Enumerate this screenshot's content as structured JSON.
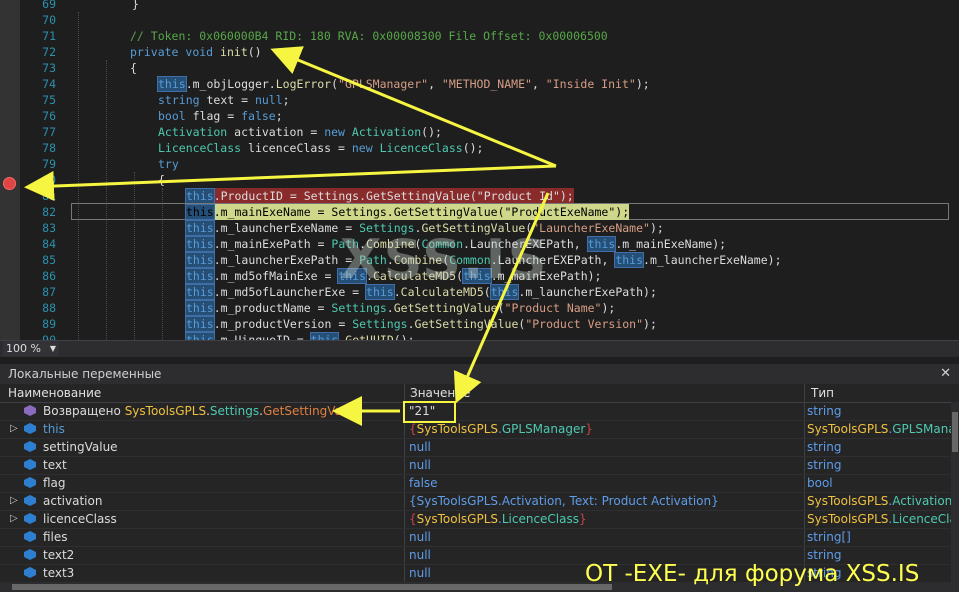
{
  "editor": {
    "lines": [
      {
        "n": "69",
        "parts": [
          {
            "t": "}",
            "c": ""
          }
        ]
      },
      {
        "n": "70",
        "parts": []
      },
      {
        "n": "71",
        "parts": [
          {
            "t": "// Token: 0x060000B4 RID: 180 RVA: 0x00008300 File Offset: 0x00006500",
            "c": "cm"
          }
        ]
      },
      {
        "n": "72",
        "parts": [
          {
            "t": "private",
            "c": "kw"
          },
          {
            "t": " ",
            "c": ""
          },
          {
            "t": "void",
            "c": "kw"
          },
          {
            "t": " ",
            "c": ""
          },
          {
            "t": "init",
            "c": "mt"
          },
          {
            "t": "()",
            "c": ""
          }
        ]
      },
      {
        "n": "73",
        "parts": [
          {
            "t": "{",
            "c": ""
          }
        ]
      },
      {
        "n": "74",
        "parts": [
          {
            "t": "this",
            "c": "kw this-hl"
          },
          {
            "t": ".m_objLogger.",
            "c": ""
          },
          {
            "t": "LogError",
            "c": "mt"
          },
          {
            "t": "(",
            "c": ""
          },
          {
            "t": "\"GPLSManager\"",
            "c": "st"
          },
          {
            "t": ", ",
            "c": ""
          },
          {
            "t": "\"METHOD_NAME\"",
            "c": "st"
          },
          {
            "t": ", ",
            "c": ""
          },
          {
            "t": "\"Inside Init\"",
            "c": "st"
          },
          {
            "t": ");",
            "c": ""
          }
        ]
      },
      {
        "n": "75",
        "parts": [
          {
            "t": "string",
            "c": "kw"
          },
          {
            "t": " text = ",
            "c": ""
          },
          {
            "t": "null",
            "c": "kw"
          },
          {
            "t": ";",
            "c": ""
          }
        ]
      },
      {
        "n": "76",
        "parts": [
          {
            "t": "bool",
            "c": "kw"
          },
          {
            "t": " flag = ",
            "c": ""
          },
          {
            "t": "false",
            "c": "kw"
          },
          {
            "t": ";",
            "c": ""
          }
        ]
      },
      {
        "n": "77",
        "parts": [
          {
            "t": "Activation",
            "c": "ty"
          },
          {
            "t": " activation = ",
            "c": ""
          },
          {
            "t": "new",
            "c": "kw"
          },
          {
            "t": " ",
            "c": ""
          },
          {
            "t": "Activation",
            "c": "ty"
          },
          {
            "t": "();",
            "c": ""
          }
        ]
      },
      {
        "n": "78",
        "parts": [
          {
            "t": "LicenceClass",
            "c": "ty"
          },
          {
            "t": " licenceClass = ",
            "c": ""
          },
          {
            "t": "new",
            "c": "kw"
          },
          {
            "t": " ",
            "c": ""
          },
          {
            "t": "LicenceClass",
            "c": "ty"
          },
          {
            "t": "();",
            "c": ""
          }
        ]
      },
      {
        "n": "79",
        "parts": [
          {
            "t": "try",
            "c": "kw"
          }
        ]
      },
      {
        "n": "80",
        "parts": [
          {
            "t": "{",
            "c": ""
          }
        ]
      },
      {
        "n": "81",
        "parts": [
          {
            "t": "this",
            "c": "kw this-hl"
          },
          {
            "t": ".ProductID = Settings.GetSettingValue(\"Product Id\");",
            "c": ""
          }
        ]
      },
      {
        "n": "82",
        "parts": [
          {
            "t": "this",
            "c": "this-hl"
          },
          {
            "t": ".m_mainExeName = Settings.GetSettingValue(\"ProductExeName\");",
            "c": ""
          }
        ]
      },
      {
        "n": "83",
        "parts": [
          {
            "t": "this",
            "c": "kw this-hl"
          },
          {
            "t": ".m_launcherExeName = ",
            "c": ""
          },
          {
            "t": "Settings",
            "c": "ty"
          },
          {
            "t": ".",
            "c": ""
          },
          {
            "t": "GetSettingValue",
            "c": "mt"
          },
          {
            "t": "(",
            "c": ""
          },
          {
            "t": "\"LauncherExeName\"",
            "c": "st"
          },
          {
            "t": ");",
            "c": ""
          }
        ]
      },
      {
        "n": "84",
        "parts": [
          {
            "t": "this",
            "c": "kw this-hl"
          },
          {
            "t": ".m_mainExePath = ",
            "c": ""
          },
          {
            "t": "Path",
            "c": "ty"
          },
          {
            "t": ".",
            "c": ""
          },
          {
            "t": "Combine",
            "c": "mt"
          },
          {
            "t": "(",
            "c": ""
          },
          {
            "t": "Common",
            "c": "ty"
          },
          {
            "t": ".LauncherEXEPath, ",
            "c": ""
          },
          {
            "t": "this",
            "c": "kw this-hl"
          },
          {
            "t": ".m_mainExeName);",
            "c": ""
          }
        ]
      },
      {
        "n": "85",
        "parts": [
          {
            "t": "this",
            "c": "kw this-hl"
          },
          {
            "t": ".m_launcherExePath = ",
            "c": ""
          },
          {
            "t": "Path",
            "c": "ty"
          },
          {
            "t": ".",
            "c": ""
          },
          {
            "t": "Combine",
            "c": "mt"
          },
          {
            "t": "(",
            "c": ""
          },
          {
            "t": "Common",
            "c": "ty"
          },
          {
            "t": ".LauncherEXEPath, ",
            "c": ""
          },
          {
            "t": "this",
            "c": "kw this-hl"
          },
          {
            "t": ".m_launcherExeName);",
            "c": ""
          }
        ]
      },
      {
        "n": "86",
        "parts": [
          {
            "t": "this",
            "c": "kw this-hl"
          },
          {
            "t": ".m_md5ofMainExe = ",
            "c": ""
          },
          {
            "t": "this",
            "c": "kw this-hl"
          },
          {
            "t": ".",
            "c": ""
          },
          {
            "t": "CalculateMD5",
            "c": "mt"
          },
          {
            "t": "(",
            "c": ""
          },
          {
            "t": "this",
            "c": "kw this-hl"
          },
          {
            "t": ".m_mainExePath);",
            "c": ""
          }
        ]
      },
      {
        "n": "87",
        "parts": [
          {
            "t": "this",
            "c": "kw this-hl"
          },
          {
            "t": ".m_md5ofLauncherExe = ",
            "c": ""
          },
          {
            "t": "this",
            "c": "kw this-hl"
          },
          {
            "t": ".",
            "c": ""
          },
          {
            "t": "CalculateMD5",
            "c": "mt"
          },
          {
            "t": "(",
            "c": ""
          },
          {
            "t": "this",
            "c": "kw this-hl"
          },
          {
            "t": ".m_launcherExePath);",
            "c": ""
          }
        ]
      },
      {
        "n": "88",
        "parts": [
          {
            "t": "this",
            "c": "kw this-hl"
          },
          {
            "t": ".m_productName = ",
            "c": ""
          },
          {
            "t": "Settings",
            "c": "ty"
          },
          {
            "t": ".",
            "c": ""
          },
          {
            "t": "GetSettingValue",
            "c": "mt"
          },
          {
            "t": "(",
            "c": ""
          },
          {
            "t": "\"Product Name\"",
            "c": "st"
          },
          {
            "t": ");",
            "c": ""
          }
        ]
      },
      {
        "n": "89",
        "parts": [
          {
            "t": "this",
            "c": "kw this-hl"
          },
          {
            "t": ".m_productVersion = ",
            "c": ""
          },
          {
            "t": "Settings",
            "c": "ty"
          },
          {
            "t": ".",
            "c": ""
          },
          {
            "t": "GetSettingValue",
            "c": "mt"
          },
          {
            "t": "(",
            "c": ""
          },
          {
            "t": "\"Product Version\"",
            "c": "st"
          },
          {
            "t": ");",
            "c": ""
          }
        ]
      },
      {
        "n": "90",
        "parts": [
          {
            "t": "this",
            "c": "kw this-hl"
          },
          {
            "t": ".m_UinqueID = ",
            "c": ""
          },
          {
            "t": "this",
            "c": "kw this-hl"
          },
          {
            "t": ".",
            "c": ""
          },
          {
            "t": "GetUUID",
            "c": "mt"
          },
          {
            "t": "();",
            "c": ""
          }
        ]
      }
    ]
  },
  "zoom": "100 %",
  "locals": {
    "title": "Локальные переменные",
    "close": "✕",
    "headers": {
      "name": "Наименование",
      "value": "Значение",
      "type": "Тип"
    },
    "rows": [
      {
        "expand": "",
        "name_parts": [
          {
            "t": "Возвращено ",
            "c": ""
          },
          {
            "t": "SysToolsGPLS",
            "c": "ns"
          },
          {
            "t": ".",
            "c": ""
          },
          {
            "t": "Settings",
            "c": "cls"
          },
          {
            "t": ".",
            "c": ""
          },
          {
            "t": "GetSettingValue",
            "c": "met"
          }
        ],
        "value_parts": [
          {
            "t": "\"21\"",
            "c": "q"
          }
        ],
        "type_parts": [
          {
            "t": "string",
            "c": ""
          }
        ],
        "icon": "return"
      },
      {
        "expand": "▷",
        "name_parts": [
          {
            "t": "this",
            "c": "kwn"
          }
        ],
        "value_parts": [
          {
            "t": "{",
            "c": "br"
          },
          {
            "t": "SysToolsGPLS",
            "c": "ns"
          },
          {
            "t": ".",
            "c": ""
          },
          {
            "t": "GPLSManager",
            "c": "cls"
          },
          {
            "t": "}",
            "c": "br"
          }
        ],
        "type_parts": [
          {
            "t": "SysToolsGPLS",
            "c": "ns"
          },
          {
            "t": ".",
            "c": ""
          },
          {
            "t": "GPLSManage",
            "c": "cls"
          }
        ],
        "icon": "field"
      },
      {
        "expand": "",
        "name_parts": [
          {
            "t": "settingValue",
            "c": ""
          }
        ],
        "value_parts": [
          {
            "t": "null",
            "c": ""
          }
        ],
        "type_parts": [
          {
            "t": "string",
            "c": ""
          }
        ],
        "icon": "field"
      },
      {
        "expand": "",
        "name_parts": [
          {
            "t": "text",
            "c": ""
          }
        ],
        "value_parts": [
          {
            "t": "null",
            "c": ""
          }
        ],
        "type_parts": [
          {
            "t": "string",
            "c": ""
          }
        ],
        "icon": "field"
      },
      {
        "expand": "",
        "name_parts": [
          {
            "t": "flag",
            "c": ""
          }
        ],
        "value_parts": [
          {
            "t": "false",
            "c": ""
          }
        ],
        "type_parts": [
          {
            "t": "bool",
            "c": ""
          }
        ],
        "icon": "field"
      },
      {
        "expand": "▷",
        "name_parts": [
          {
            "t": "activation",
            "c": ""
          }
        ],
        "value_parts": [
          {
            "t": "{SysToolsGPLS.Activation, Text: Product Activation}",
            "c": ""
          }
        ],
        "type_parts": [
          {
            "t": "SysToolsGPLS",
            "c": "ns"
          },
          {
            "t": ".",
            "c": ""
          },
          {
            "t": "Activation",
            "c": "cls"
          }
        ],
        "icon": "field"
      },
      {
        "expand": "▷",
        "name_parts": [
          {
            "t": "licenceClass",
            "c": ""
          }
        ],
        "value_parts": [
          {
            "t": "{",
            "c": "br"
          },
          {
            "t": "SysToolsGPLS",
            "c": "ns"
          },
          {
            "t": ".",
            "c": ""
          },
          {
            "t": "LicenceClass",
            "c": "cls"
          },
          {
            "t": "}",
            "c": "br"
          }
        ],
        "type_parts": [
          {
            "t": "SysToolsGPLS",
            "c": "ns"
          },
          {
            "t": ".",
            "c": ""
          },
          {
            "t": "LicenceClass",
            "c": "cls"
          }
        ],
        "icon": "field"
      },
      {
        "expand": "",
        "name_parts": [
          {
            "t": "files",
            "c": ""
          }
        ],
        "value_parts": [
          {
            "t": "null",
            "c": ""
          }
        ],
        "type_parts": [
          {
            "t": "string[]",
            "c": ""
          }
        ],
        "icon": "field"
      },
      {
        "expand": "",
        "name_parts": [
          {
            "t": "text2",
            "c": ""
          }
        ],
        "value_parts": [
          {
            "t": "null",
            "c": ""
          }
        ],
        "type_parts": [
          {
            "t": "string",
            "c": ""
          }
        ],
        "icon": "field"
      },
      {
        "expand": "",
        "name_parts": [
          {
            "t": "text3",
            "c": ""
          }
        ],
        "value_parts": [
          {
            "t": "null",
            "c": ""
          }
        ],
        "type_parts": [
          {
            "t": "string",
            "c": ""
          }
        ],
        "icon": "field"
      }
    ]
  },
  "overlay": {
    "watermark": "XSS.IS",
    "signature": "OT -EXE- для форума XSS.IS",
    "arrow_color": "#f5f542"
  },
  "colors": {
    "breakpoint": "#d44444",
    "current_line": "#cfd88a",
    "this_highlight": "#264f78"
  }
}
